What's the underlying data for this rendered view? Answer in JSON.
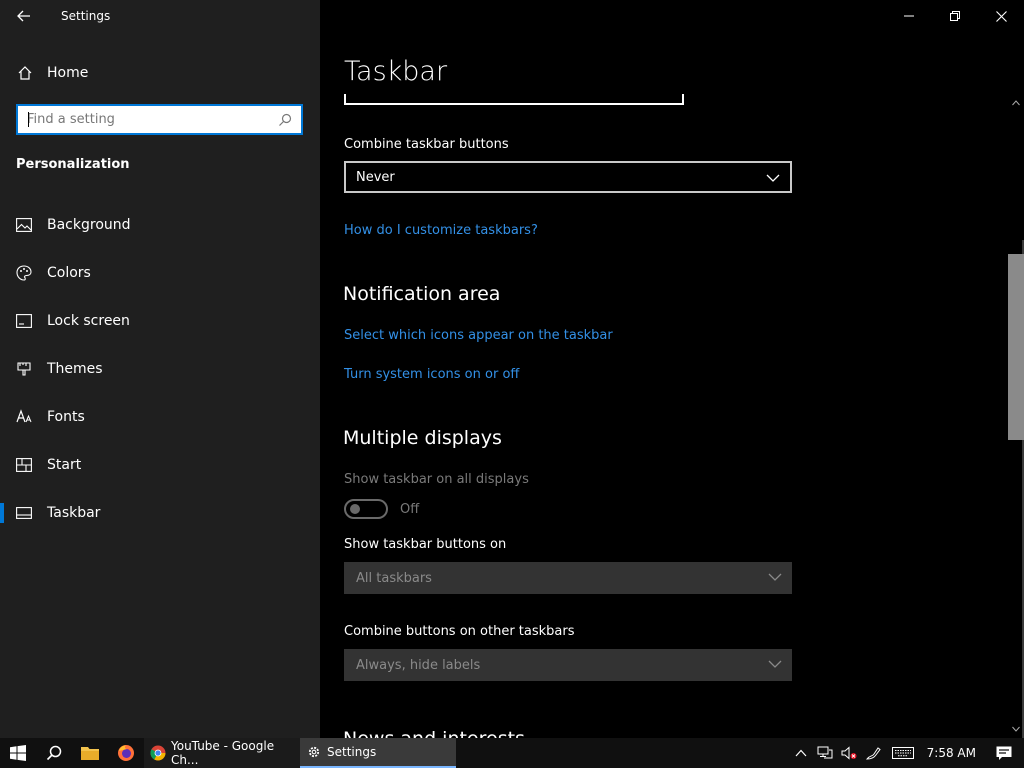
{
  "window": {
    "title": "Settings"
  },
  "sidebar": {
    "home_label": "Home",
    "search_placeholder": "Find a setting",
    "section": "Personalization",
    "items": [
      {
        "label": "Background",
        "icon": "image-icon"
      },
      {
        "label": "Colors",
        "icon": "palette-icon"
      },
      {
        "label": "Lock screen",
        "icon": "lock-screen-icon"
      },
      {
        "label": "Themes",
        "icon": "brush-icon"
      },
      {
        "label": "Fonts",
        "icon": "font-icon"
      },
      {
        "label": "Start",
        "icon": "start-tiles-icon"
      },
      {
        "label": "Taskbar",
        "icon": "taskbar-icon",
        "selected": true
      }
    ]
  },
  "main": {
    "page_title": "Taskbar",
    "combine_label": "Combine taskbar buttons",
    "combine_value": "Never",
    "customize_link": "How do I customize taskbars?",
    "notification_head": "Notification area",
    "icons_link": "Select which icons appear on the taskbar",
    "system_icons_link": "Turn system icons on or off",
    "multiple_head": "Multiple displays",
    "show_all_label": "Show taskbar on all displays",
    "toggle_state": "Off",
    "show_buttons_label": "Show taskbar buttons on",
    "show_buttons_value": "All taskbars",
    "combine_other_label": "Combine buttons on other taskbars",
    "combine_other_value": "Always, hide labels",
    "next_head": "News and interests"
  },
  "taskbar": {
    "chrome_app": "YouTube - Google Ch...",
    "settings_app": "Settings",
    "time": "7:58 AM"
  },
  "colors": {
    "accent": "#0078d7",
    "link": "#3390e6"
  }
}
